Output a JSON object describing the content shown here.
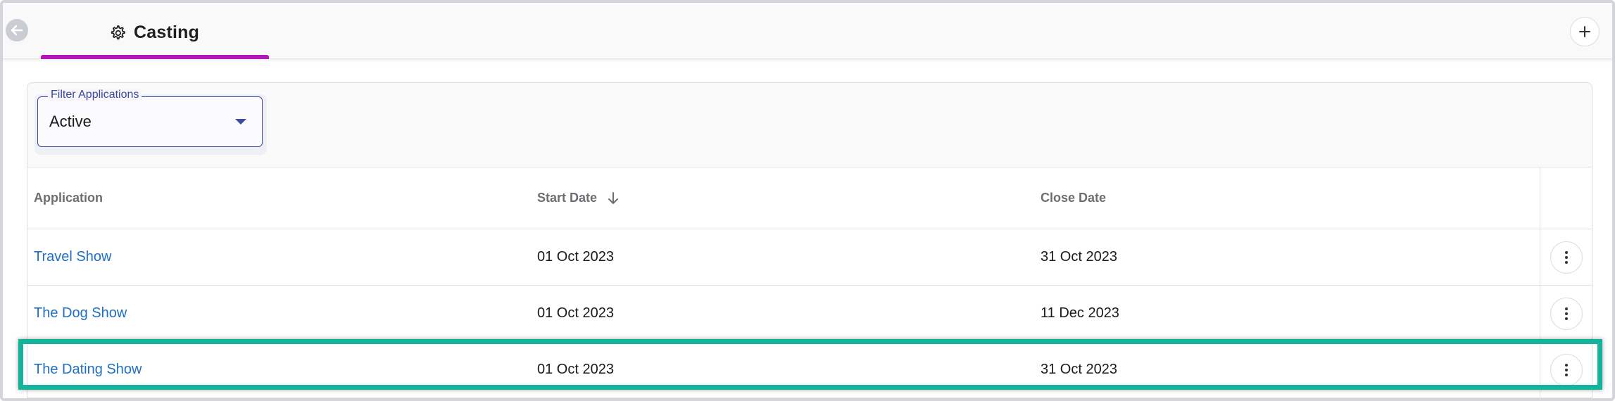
{
  "header": {
    "tab_title": "Casting",
    "colors": {
      "accent_underline": "#b316b9",
      "highlight": "#14b39b",
      "link": "#1f6fc6"
    },
    "icons": {
      "back": "arrow-left-icon",
      "tab": "gear-icon",
      "add": "plus-icon"
    }
  },
  "filter": {
    "label": "Filter Applications",
    "value": "Active"
  },
  "table": {
    "columns": {
      "application": "Application",
      "start_date": "Start Date",
      "close_date": "Close Date"
    },
    "sort_icon": "arrow-down-icon",
    "rows": [
      {
        "application": "Travel Show",
        "start_date": "01 Oct 2023",
        "close_date": "31 Oct 2023"
      },
      {
        "application": "The Dog Show",
        "start_date": "01 Oct 2023",
        "close_date": "11 Dec 2023"
      },
      {
        "application": "The Dating Show",
        "start_date": "01 Oct 2023",
        "close_date": "31 Oct 2023"
      }
    ],
    "row_menu_icon": "kebab-menu-icon"
  }
}
